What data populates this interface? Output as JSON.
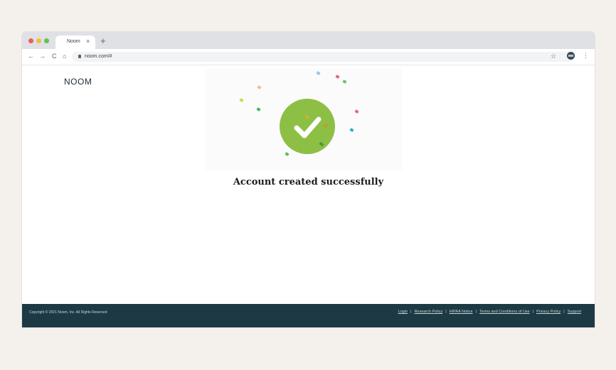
{
  "browser": {
    "tab_title": "Noom",
    "tab_close": "×",
    "new_tab": "+",
    "url": "noom.com/#",
    "nav": {
      "back": "←",
      "forward": "→",
      "reload": "C",
      "home": "⌂"
    },
    "star": "☆",
    "menu": "⋮"
  },
  "page": {
    "logo": "NOOM",
    "message": "Account created successfully",
    "colors": {
      "check_circle": "#8ebf45",
      "footer": "#1d3a44"
    }
  },
  "footer": {
    "copyright": "Copyright © 2021 Noom, Inc. All Rights Reserved",
    "links": [
      "Login",
      "Research Policy",
      "HIPAA Notice",
      "Terms and Conditions of Use",
      "Privacy Policy",
      "Support"
    ],
    "separator": "|"
  }
}
